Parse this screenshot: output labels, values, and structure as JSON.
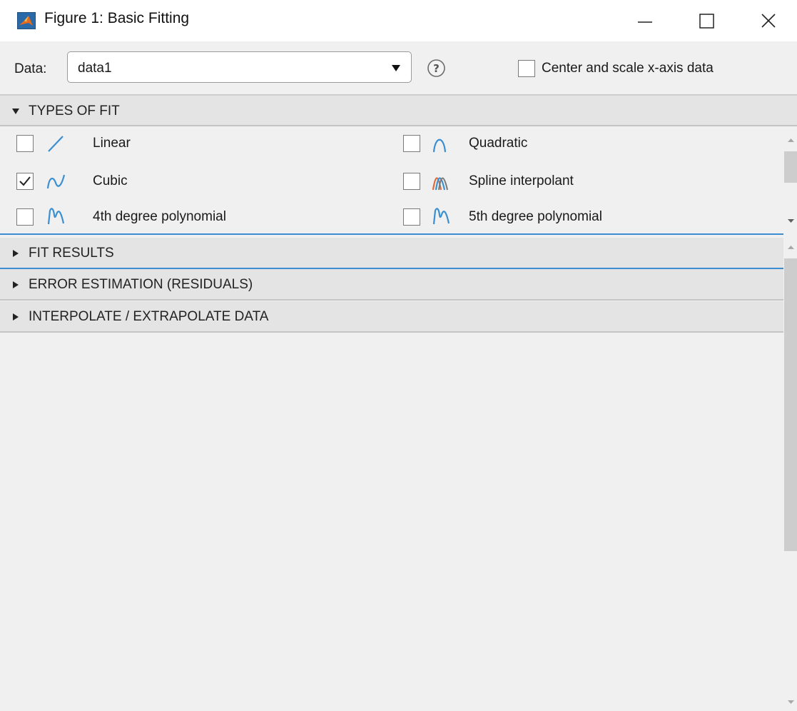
{
  "window": {
    "title": "Figure 1: Basic Fitting"
  },
  "data_selector": {
    "label": "Data:",
    "selected": "data1",
    "center_scale_label": "Center and scale x-axis data",
    "center_scale_checked": false
  },
  "sections": {
    "types_of_fit": "TYPES OF FIT",
    "fit_results": "FIT RESULTS",
    "error_estimation": "ERROR ESTIMATION (RESIDUALS)",
    "interpolate": "INTERPOLATE / EXTRAPOLATE DATA"
  },
  "fits": [
    {
      "label": "Linear",
      "checked": false,
      "icon": "linear-icon"
    },
    {
      "label": "Quadratic",
      "checked": false,
      "icon": "quadratic-icon"
    },
    {
      "label": "Cubic",
      "checked": true,
      "icon": "cubic-icon"
    },
    {
      "label": "Spline interpolant",
      "checked": false,
      "icon": "spline-icon"
    },
    {
      "label": "4th degree polynomial",
      "checked": false,
      "icon": "poly4-icon"
    },
    {
      "label": "5th degree polynomial",
      "checked": false,
      "icon": "poly5-icon"
    }
  ],
  "colors": {
    "accent": "#3d8ccd",
    "curve_blue": "#3b8fd0"
  }
}
